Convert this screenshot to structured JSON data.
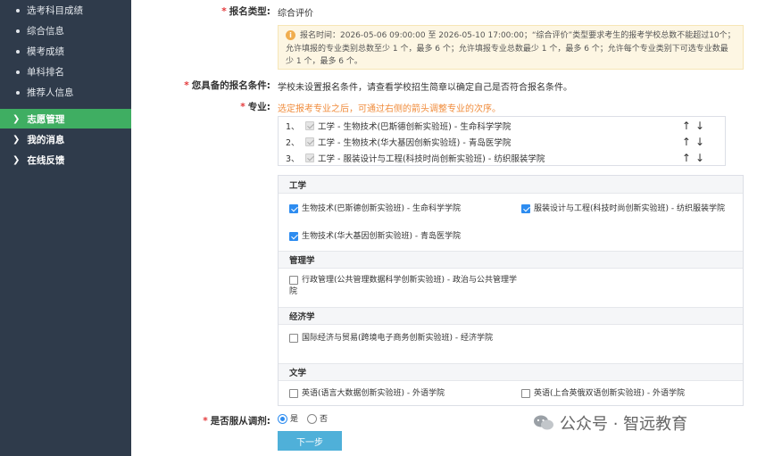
{
  "sidebar": {
    "sub_items": [
      "选考科目成绩",
      "综合信息",
      "模考成绩",
      "单科排名",
      "推荐人信息"
    ],
    "top_items": [
      {
        "label": "志愿管理",
        "active": true
      },
      {
        "label": "我的消息",
        "active": false
      },
      {
        "label": "在线反馈",
        "active": false
      }
    ]
  },
  "form": {
    "reg_type_label": "报名类型:",
    "reg_type_value": "综合评价",
    "notice": "报名时间：2026-05-06 09:00:00 至 2026-05-10 17:00:00；“综合评价”类型要求考生的报考学校总数不能超过10个；允许填报的专业类别总数至少 1 个，最多 6 个；允许填报专业总数最少 1 个，最多 6 个；允许每个专业类别下可选专业数最少 1 个，最多 6 个。",
    "cond_label": "您具备的报名条件:",
    "cond_value": "学校未设置报名条件，请查看学校招生简章以确定自己是否符合报名条件。",
    "major_label": "专业:",
    "major_hint": "选定报考专业之后，可通过右侧的箭头调整专业的次序。",
    "selected": [
      {
        "index": "1、",
        "text": "工学 - 生物技术(巴斯德创新实验班) - 生命科学学院"
      },
      {
        "index": "2、",
        "text": "工学 - 生物技术(华大基因创新实验班) - 青岛医学院"
      },
      {
        "index": "3、",
        "text": "工学 - 服装设计与工程(科技时尚创新实验班) - 纺织服装学院"
      }
    ],
    "arrows": "↑↓",
    "categories": [
      {
        "name": "工学",
        "options": [
          {
            "text": "生物技术(巴斯德创新实验班) - 生命科学学院",
            "checked": true
          },
          {
            "text": "服装设计与工程(科技时尚创新实验班) - 纺织服装学院",
            "checked": true
          },
          {
            "text": "生物技术(华大基因创新实验班) - 青岛医学院",
            "checked": true
          }
        ]
      },
      {
        "name": "管理学",
        "options": [
          {
            "text": "行政管理(公共管理数据科学创新实验班) - 政治与公共管理学院",
            "checked": false
          }
        ]
      },
      {
        "name": "经济学",
        "options": [
          {
            "text": "国际经济与贸易(跨境电子商务创新实验班) - 经济学院",
            "checked": false
          }
        ]
      },
      {
        "name": "文学",
        "options": [
          {
            "text": "英语(语言大数据创新实验班) - 外语学院",
            "checked": false
          },
          {
            "text": "英语(上合英俄双语创新实验班) - 外语学院",
            "checked": false
          }
        ]
      }
    ],
    "adjust_label": "是否服从调剂:",
    "adjust_yes": "是",
    "adjust_no": "否",
    "next_button": "下一步"
  },
  "watermark": "公众号 · 智远教育"
}
